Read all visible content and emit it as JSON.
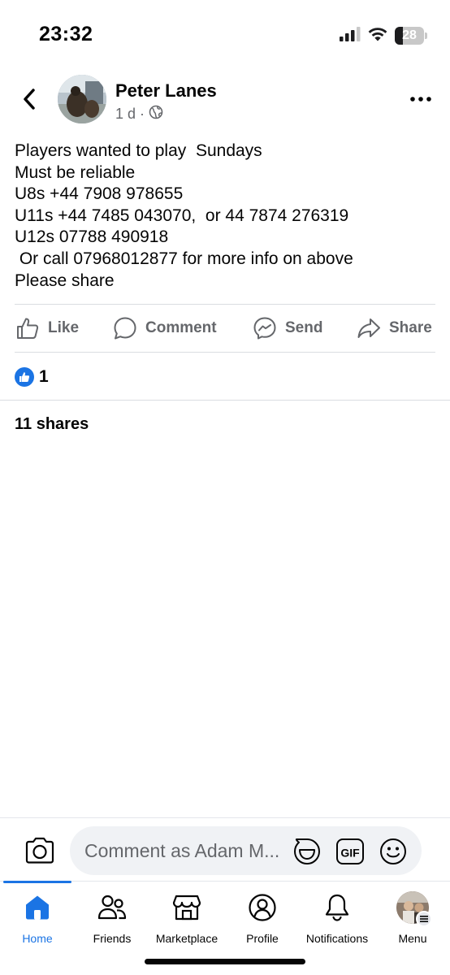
{
  "status_bar": {
    "time": "23:32",
    "battery": "28",
    "battery_level": 0.28,
    "icons": [
      "cellular-signal-icon",
      "wifi-icon",
      "battery-icon"
    ]
  },
  "header": {
    "author_name": "Peter Lanes",
    "timestamp": "1 d",
    "meta_separator": "·",
    "audience_icon": "globe-icon"
  },
  "post": {
    "lines": [
      "Players wanted to play  Sundays",
      "Must be reliable",
      "U8s +44 7908 978655",
      "U11s +44 7485 043070,  or 44 7874 276319",
      "U12s 07788 490918",
      " Or call 07968012877 for more info on above",
      "Please share"
    ]
  },
  "actions": {
    "like": "Like",
    "comment": "Comment",
    "send": "Send",
    "share": "Share"
  },
  "engagement": {
    "reaction_count": "1",
    "shares": "11 shares"
  },
  "comment_bar": {
    "placeholder": "Comment as Adam M..."
  },
  "tabs": [
    {
      "label": "Home",
      "icon": "home-icon",
      "active": true
    },
    {
      "label": "Friends",
      "icon": "friends-icon"
    },
    {
      "label": "Marketplace",
      "icon": "marketplace-icon"
    },
    {
      "label": "Profile",
      "icon": "profile-icon"
    },
    {
      "label": "Notifications",
      "icon": "bell-icon"
    },
    {
      "label": "Menu",
      "icon": "avatar"
    }
  ],
  "colors": {
    "accent": "#1b74e4",
    "secondary_text": "#65676b",
    "divider": "#dadde1"
  }
}
